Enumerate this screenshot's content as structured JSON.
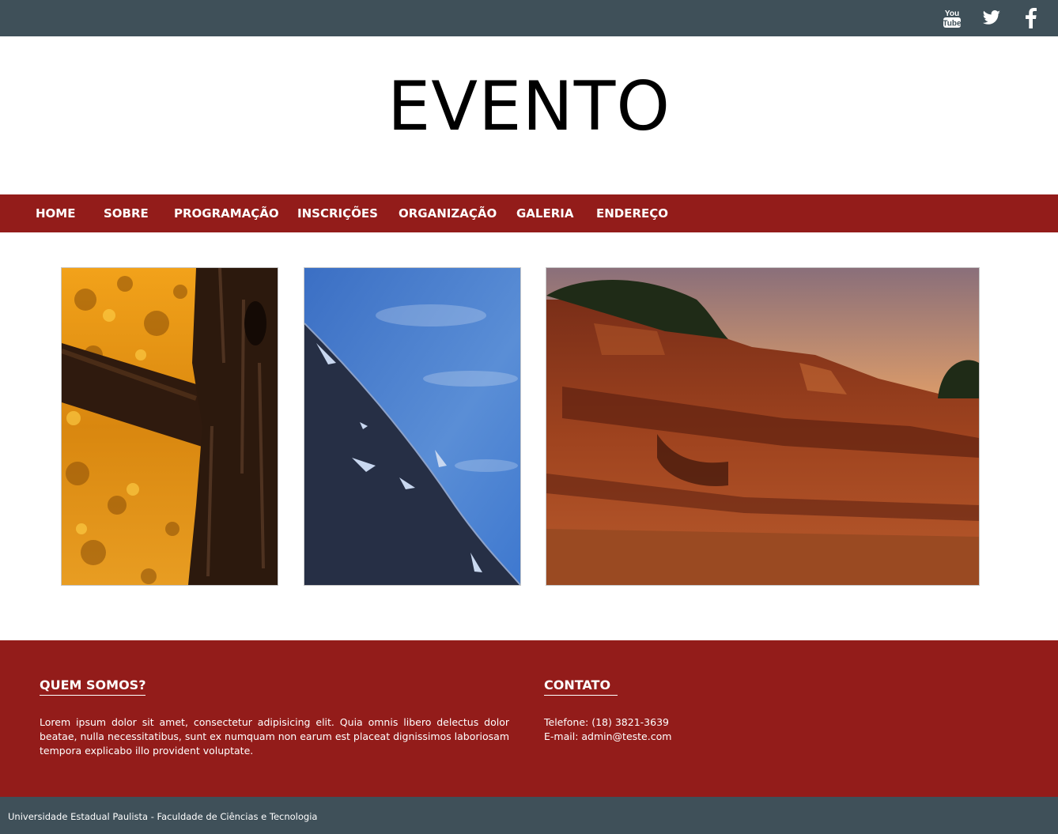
{
  "topbar": {
    "social": [
      {
        "icon": "youtube-icon",
        "label": "You Tube"
      },
      {
        "icon": "twitter-icon"
      },
      {
        "icon": "facebook-icon"
      }
    ]
  },
  "header": {
    "title": "EVENTO"
  },
  "nav": {
    "items": [
      "HOME",
      "SOBRE",
      "PROGRAMAÇÃO",
      "INSCRIÇÕES",
      "ORGANIZAÇÃO",
      "GALERIA",
      "ENDEREÇO"
    ]
  },
  "gallery": {
    "images": [
      {
        "name": "autumn-tree-photo"
      },
      {
        "name": "rock-and-sky-photo"
      },
      {
        "name": "red-rock-canyon-photo"
      }
    ]
  },
  "footer": {
    "about": {
      "heading": "QUEM SOMOS?",
      "text": "Lorem ipsum dolor sit amet, consectetur adipisicing elit. Quia omnis libero delectus dolor beatae, nulla necessitatibus, sunt ex numquam non earum est placeat dignissimos laboriosam tempora explicabo illo provident voluptate."
    },
    "contact": {
      "heading": "CONTATO",
      "phone": "Telefone: (18) 3821-3639",
      "email": "E-mail: admin@teste.com"
    }
  },
  "bottombar": {
    "copyright": "Universidade Estadual Paulista - Faculdade de Ciências e Tecnologia"
  },
  "colors": {
    "topbar": "#3f5059",
    "accent": "#931c1a",
    "text_light": "#ffffff"
  }
}
